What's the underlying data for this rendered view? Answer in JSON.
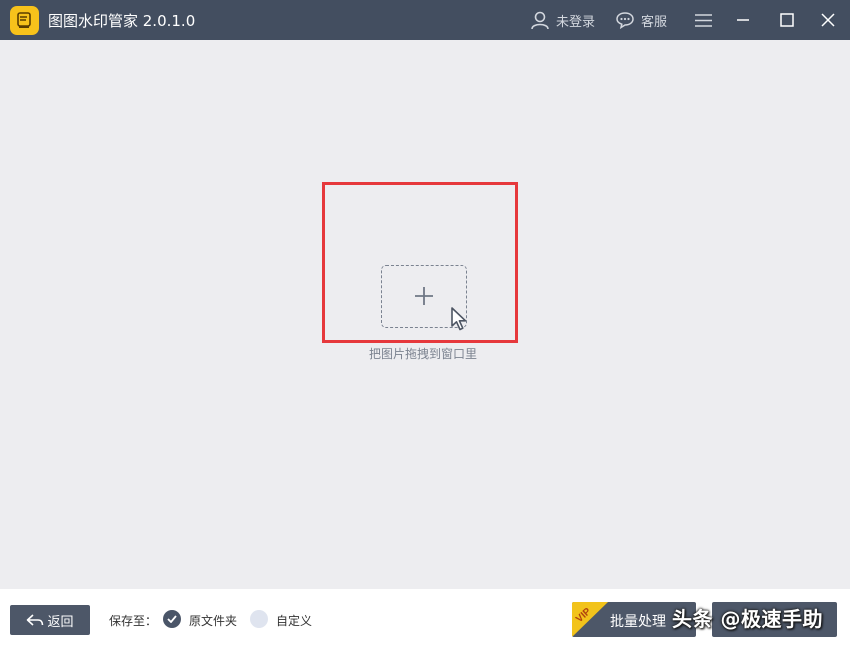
{
  "app": {
    "title": "图图水印管家  2.0.1.0"
  },
  "header": {
    "login_label": "未登录",
    "service_label": "客服"
  },
  "main": {
    "drop_hint": "把图片拖拽到窗口里"
  },
  "footer": {
    "back_label": "返回",
    "save_to_label": "保存至：",
    "options": [
      {
        "label": "原文件夹",
        "selected": true
      },
      {
        "label": "自定义",
        "selected": false
      }
    ],
    "batch_label": "批量处理",
    "vip_badge": "VIP"
  },
  "watermark": {
    "text": "头条 @极速手助"
  },
  "colors": {
    "titlebar": "#434e60",
    "canvas": "#ededf0",
    "highlight": "#e6383c",
    "button": "#4d5768",
    "logo": "#f7c21b"
  }
}
